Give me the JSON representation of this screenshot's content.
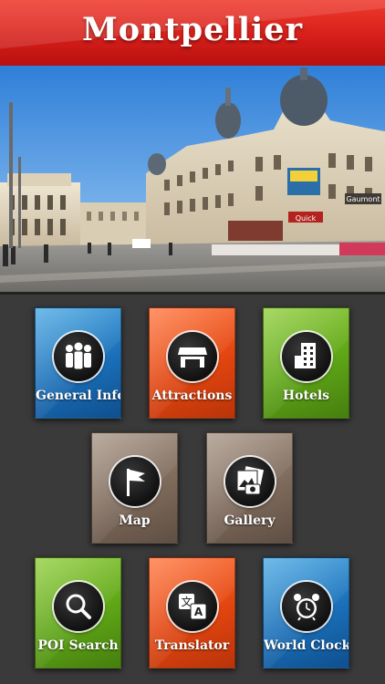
{
  "header": {
    "title": "Montpellier"
  },
  "photo": {
    "description_icon": "city-square-photo",
    "sign_text": "Quick",
    "sign_text2": "Gaumont"
  },
  "tiles": [
    {
      "label": "General Info",
      "icon": "people-icon",
      "color": "#1a6fb8"
    },
    {
      "label": "Attractions",
      "icon": "storefront-icon",
      "color": "#e2450f"
    },
    {
      "label": "Hotels",
      "icon": "building-icon",
      "color": "#5ea516"
    },
    {
      "label": "Map",
      "icon": "flag-icon",
      "color": "#7d6a5b"
    },
    {
      "label": "Gallery",
      "icon": "photos-icon",
      "color": "#7d6a5b"
    },
    {
      "label": "POI Search",
      "icon": "magnifier-icon",
      "color": "#5ea516"
    },
    {
      "label": "Translator",
      "icon": "translate-icon",
      "color": "#e2450f"
    },
    {
      "label": "World Clock",
      "icon": "alarm-clock-icon",
      "color": "#1a6fb8"
    }
  ]
}
